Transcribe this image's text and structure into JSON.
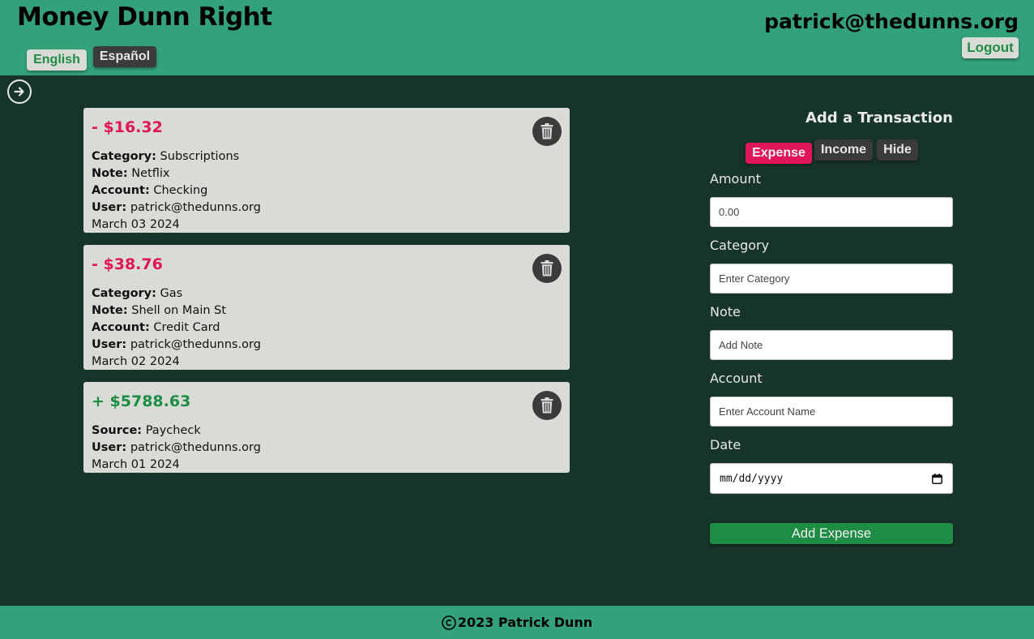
{
  "header": {
    "app_title": "Money Dunn Right",
    "languages": [
      {
        "label": "English",
        "active": true
      },
      {
        "label": "Español",
        "active": false
      }
    ],
    "user_email": "patrick@thedunns.org",
    "logout_label": "Logout"
  },
  "sidebar_toggle": {
    "icon": "arrow-right-circle-icon"
  },
  "transactions": [
    {
      "kind": "expense",
      "amount": "- $16.32",
      "rows": [
        {
          "label": "Category:",
          "value": "Subscriptions"
        },
        {
          "label": "Note:",
          "value": "Netflix"
        },
        {
          "label": "Account:",
          "value": "Checking"
        },
        {
          "label": "User:",
          "value": "patrick@thedunns.org"
        }
      ],
      "date": "March 03 2024"
    },
    {
      "kind": "expense",
      "amount": "- $38.76",
      "rows": [
        {
          "label": "Category:",
          "value": "Gas"
        },
        {
          "label": "Note:",
          "value": "Shell on Main St"
        },
        {
          "label": "Account:",
          "value": "Credit Card"
        },
        {
          "label": "User:",
          "value": "patrick@thedunns.org"
        }
      ],
      "date": "March 02 2024"
    },
    {
      "kind": "income",
      "amount": "+ $5788.63",
      "rows": [
        {
          "label": "Source:",
          "value": "Paycheck"
        },
        {
          "label": "User:",
          "value": "patrick@thedunns.org"
        }
      ],
      "date": "March 01 2024"
    }
  ],
  "form": {
    "title": "Add a Transaction",
    "type_buttons": [
      {
        "label": "Expense",
        "active": true
      },
      {
        "label": "Income",
        "active": false
      },
      {
        "label": "Hide",
        "active": false
      }
    ],
    "fields": {
      "amount": {
        "label": "Amount",
        "placeholder": "0.00"
      },
      "category": {
        "label": "Category",
        "placeholder": "Enter Category"
      },
      "note": {
        "label": "Note",
        "placeholder": "Add Note"
      },
      "account": {
        "label": "Account",
        "placeholder": "Enter Account Name"
      },
      "date": {
        "label": "Date",
        "placeholder": "mm/dd/yyyy"
      }
    },
    "submit_label": "Add Expense"
  },
  "footer": {
    "text": "2023 Patrick Dunn"
  },
  "colors": {
    "header_bg": "#33a27b",
    "page_bg": "#16342b",
    "card_bg": "#d8dbd6",
    "expense": "#e01659",
    "income": "#1f8c44",
    "dark_button": "#3b3b3b"
  }
}
